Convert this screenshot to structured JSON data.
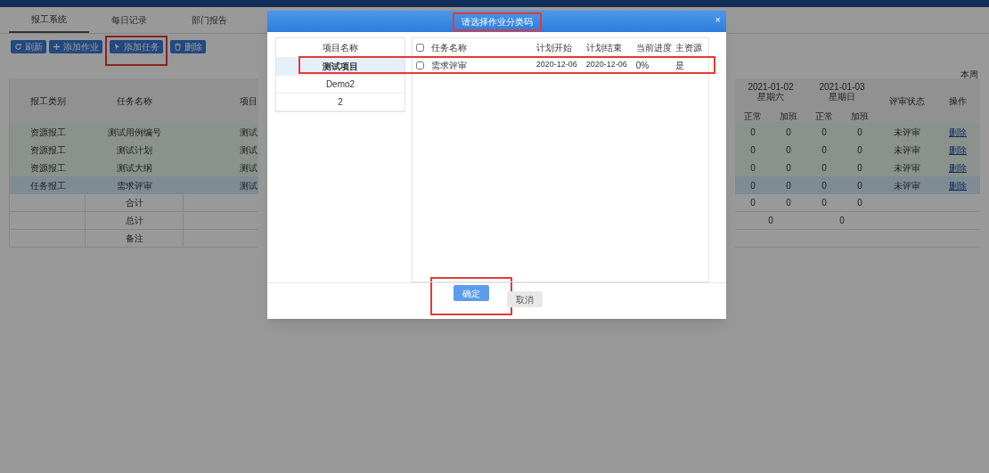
{
  "page": {
    "tabs": [
      {
        "label": "报工系统",
        "selected": true
      },
      {
        "label": "每日记录",
        "selected": false
      },
      {
        "label": "部门报告",
        "selected": false
      }
    ],
    "toolbar": [
      {
        "kind": "refresh",
        "label": "刷新",
        "highlighted": false
      },
      {
        "kind": "add",
        "label": "添加作业",
        "highlighted": false
      },
      {
        "kind": "task",
        "label": "添加任务",
        "highlighted": true
      },
      {
        "kind": "delete",
        "label": "删除",
        "highlighted": false
      }
    ],
    "period_label": "本周"
  },
  "table": {
    "left_columns": [
      "报工类别",
      "任务名称",
      "项目"
    ],
    "dates": [
      {
        "date": "2021-01-02",
        "weekday": "星期六",
        "sub_columns": [
          "正常",
          "加班"
        ]
      },
      {
        "date": "2021-01-03",
        "weekday": "星期日",
        "sub_columns": [
          "正常",
          "加班"
        ]
      }
    ],
    "status_column": "评审状态",
    "action_column": "操作",
    "rows": [
      {
        "category": "资源报工",
        "task": "测试用例编号",
        "project": "测试",
        "cells": [
          "0",
          "0",
          "0",
          "0"
        ],
        "status": "未评审",
        "action": "删除",
        "selected": false
      },
      {
        "category": "资源报工",
        "task": "测试计划",
        "project": "测试",
        "cells": [
          "0",
          "0",
          "0",
          "0"
        ],
        "status": "未评审",
        "action": "删除",
        "selected": false
      },
      {
        "category": "资源报工",
        "task": "测试大纲",
        "project": "测试",
        "cells": [
          "0",
          "0",
          "0",
          "0"
        ],
        "status": "未评审",
        "action": "删除",
        "selected": false
      },
      {
        "category": "任务报工",
        "task": "需求评审",
        "project": "测试",
        "cells": [
          "0",
          "0",
          "0",
          "0"
        ],
        "status": "未评审",
        "action": "删除",
        "selected": true
      }
    ],
    "summary": [
      {
        "label": "合计",
        "cells": [
          "0",
          "0",
          "0",
          "0"
        ]
      },
      {
        "label": "总计",
        "cells": [
          "0",
          "0"
        ]
      },
      {
        "label": "备注"
      }
    ]
  },
  "dialog": {
    "title": "请选择作业分类码",
    "title_highlighted": true,
    "close": "×",
    "project_header": "项目名称",
    "projects": [
      {
        "name": "测试项目",
        "selected": true
      },
      {
        "name": "Demo2",
        "selected": false
      },
      {
        "name": "2",
        "selected": false
      }
    ],
    "task_columns": [
      "任务名称",
      "计划开始",
      "计划结束",
      "当前进度",
      "主资源"
    ],
    "all_checked": false,
    "tasks": [
      {
        "name": "需求评审",
        "start": "2020-12-06",
        "end": "2020-12-06",
        "progress": "0%",
        "main": "是",
        "checked": false,
        "highlighted": true
      }
    ],
    "buttons": [
      {
        "kind": "primary",
        "label": "确定",
        "highlighted": true
      },
      {
        "kind": "secondary",
        "label": "取消",
        "highlighted": false
      }
    ]
  }
}
